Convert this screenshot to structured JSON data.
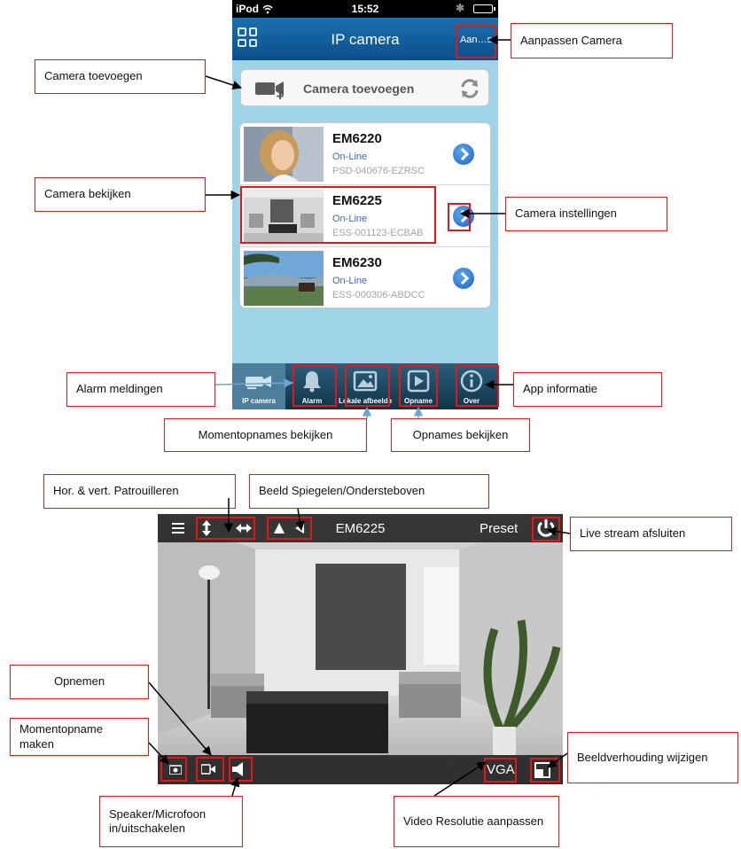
{
  "phone": {
    "status": {
      "carrier": "iPod",
      "time": "15:52"
    },
    "nav": {
      "title": "IP camera",
      "right_button": "Aan…s"
    },
    "add_camera_label": "Camera toevoegen",
    "cameras": [
      {
        "name": "EM6220",
        "status": "On-Line",
        "id": "PSD-040676-EZRSC"
      },
      {
        "name": "EM6225",
        "status": "On-Line",
        "id": "ESS-001123-ECBAB"
      },
      {
        "name": "EM6230",
        "status": "On-Line",
        "id": "ESS-000306-ABDCC"
      }
    ],
    "tabs": [
      {
        "label": "IP camera",
        "icon": "camera-icon"
      },
      {
        "label": "Alarm",
        "icon": "bell-icon"
      },
      {
        "label": "Lokale afbeelding",
        "icon": "picture-icon"
      },
      {
        "label": "Opname",
        "icon": "play-icon"
      },
      {
        "label": "Over",
        "icon": "info-icon"
      }
    ]
  },
  "live": {
    "title": "EM6225",
    "preset": "Preset",
    "resolution": "VGA"
  },
  "callouts": {
    "aanpassen_camera": "Aanpassen Camera",
    "camera_toevoegen": "Camera toevoegen",
    "camera_bekijken": "Camera bekijken",
    "camera_instellingen": "Camera instellingen",
    "alarm_meldingen": "Alarm meldingen",
    "app_informatie": "App informatie",
    "momentopnames_bekijken": "Momentopnames bekijken",
    "opnames_bekijken": "Opnames bekijken",
    "patrouilleren": "Hor. & vert. Patrouilleren",
    "spiegelen": "Beeld Spiegelen/Ondersteboven",
    "live_afsluiten": "Live stream afsluiten",
    "opnemen": "Opnemen",
    "momentopname_maken": "Momentopname maken",
    "beeldverhouding": "Beeldverhouding wijzigen",
    "speaker": "Speaker/Microfoon in/uitschakelen",
    "resolutie": "Video Resolutie aanpassen"
  },
  "colors": {
    "highlight": "#e01818",
    "navbar": "#0a4f8c",
    "screen_bg": "#9fd3e7",
    "link_blue": "#1c63c5"
  }
}
